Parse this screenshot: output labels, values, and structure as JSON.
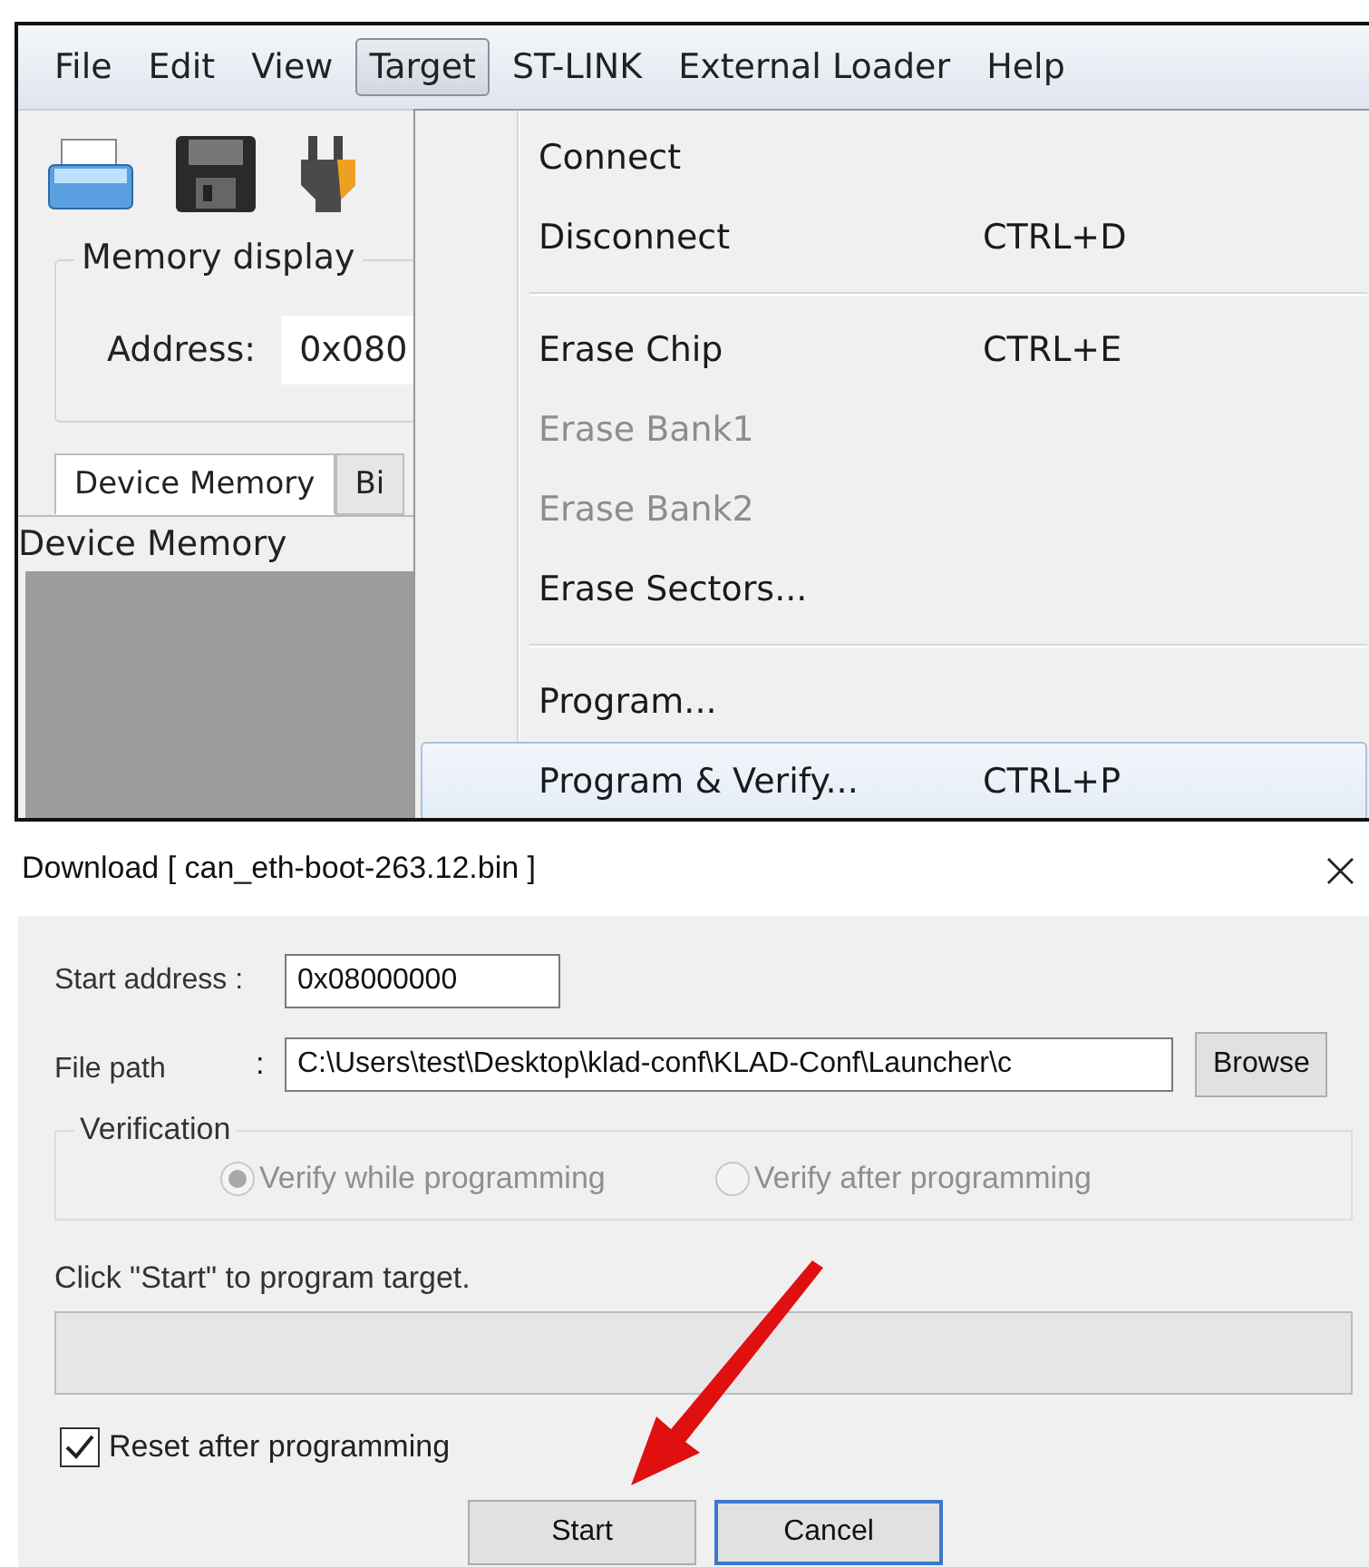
{
  "app": {
    "menu_bar": [
      {
        "label": "File",
        "selected": false
      },
      {
        "label": "Edit",
        "selected": false
      },
      {
        "label": "View",
        "selected": false
      },
      {
        "label": "Target",
        "selected": true
      },
      {
        "label": "ST-LINK",
        "selected": false
      },
      {
        "label": "External Loader",
        "selected": false
      },
      {
        "label": "Help",
        "selected": false
      }
    ],
    "memory_display": {
      "title": "Memory display",
      "address_label": "Address:",
      "address_value": "0x080"
    },
    "tabs": [
      {
        "label": "Device Memory",
        "selected": true
      },
      {
        "label": "Bi",
        "selected": false
      }
    ],
    "panel_label": "Device Memory",
    "dropdown": {
      "groups": [
        [
          {
            "label": "Connect",
            "disabled": false,
            "selected": false
          },
          {
            "label": "Disconnect",
            "shortcut": "CTRL+D",
            "disabled": false,
            "selected": false
          }
        ],
        [
          {
            "label": "Erase Chip",
            "shortcut": "CTRL+E",
            "disabled": false,
            "selected": false
          },
          {
            "label": "Erase Bank1",
            "disabled": true,
            "selected": false
          },
          {
            "label": "Erase Bank2",
            "disabled": true,
            "selected": false
          },
          {
            "label": "Erase Sectors...",
            "disabled": false,
            "selected": false
          }
        ],
        [
          {
            "label": "Program...",
            "disabled": false,
            "selected": false
          },
          {
            "label": "Program & Verify...",
            "shortcut": "CTRL+P",
            "disabled": false,
            "selected": true
          }
        ]
      ]
    }
  },
  "dialog": {
    "title": "Download [ can_eth-boot-263.12.bin ]",
    "close": "×",
    "start_address_label": "Start address :",
    "start_address_value": "0x08000000",
    "file_path_label": "File path",
    "file_path_colon": ":",
    "file_path_value": "C:\\Users\\test\\Desktop\\klad-conf\\KLAD-Conf\\Launcher\\c",
    "browse": "Browse",
    "verification": {
      "title": "Verification",
      "disabled": true,
      "options": [
        {
          "label": "Verify while programming",
          "selected": true
        },
        {
          "label": "Verify after programming",
          "selected": false
        }
      ]
    },
    "status": "Click \"Start\" to program target.",
    "progress": {
      "level": 0
    },
    "reset": {
      "label": "Reset after programming",
      "checked": true
    },
    "buttons": [
      {
        "label": "Start",
        "default": false
      },
      {
        "label": "Cancel",
        "default": true
      }
    ]
  }
}
